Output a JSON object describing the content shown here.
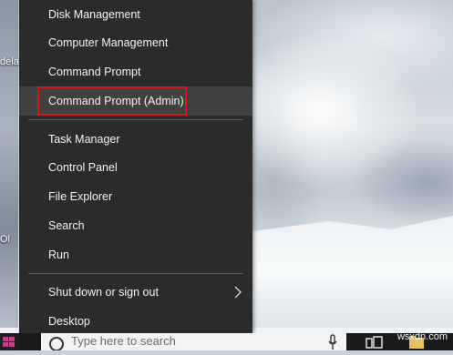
{
  "desktop": {
    "labels": [
      "dela",
      "Ol"
    ]
  },
  "menu": {
    "items": [
      {
        "label": "Disk Management"
      },
      {
        "label": "Computer Management"
      },
      {
        "label": "Command Prompt"
      },
      {
        "label": "Command Prompt (Admin)",
        "highlighted": true
      },
      {
        "label": "Task Manager"
      },
      {
        "label": "Control Panel"
      },
      {
        "label": "File Explorer"
      },
      {
        "label": "Search"
      },
      {
        "label": "Run"
      },
      {
        "label": "Shut down or sign out",
        "submenu": true
      },
      {
        "label": "Desktop"
      }
    ],
    "highlight_color": "#d8161c"
  },
  "taskbar": {
    "search_placeholder": "Type here to search",
    "watermark": "wsxdn.com"
  }
}
